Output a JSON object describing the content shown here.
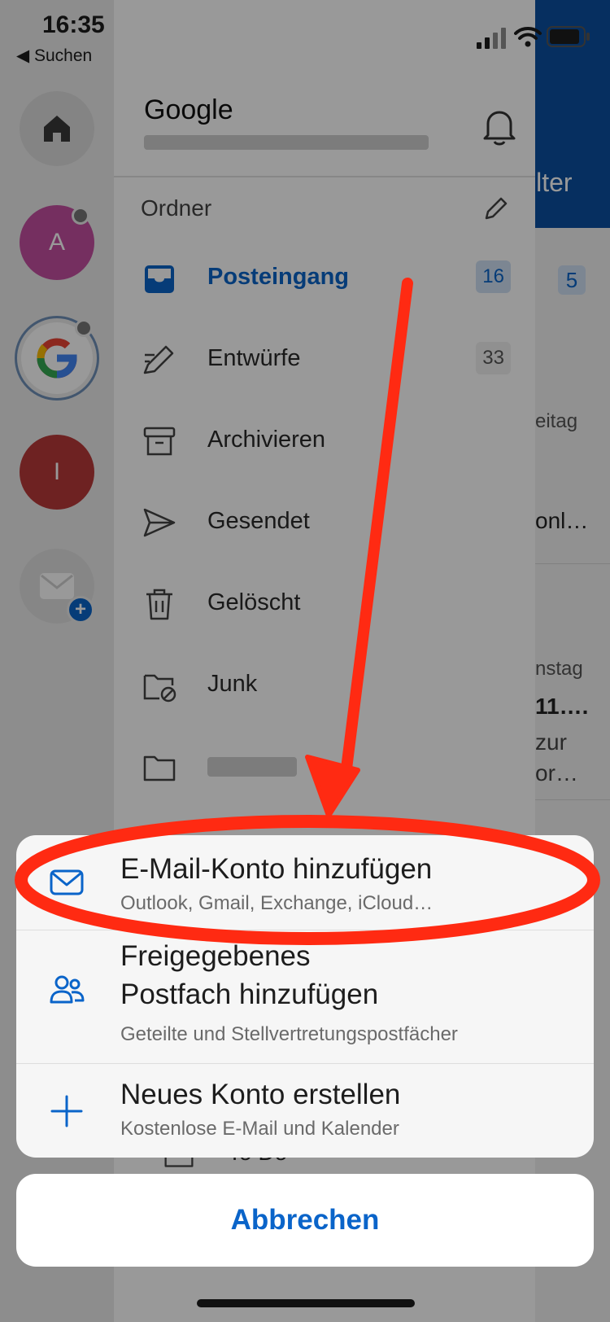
{
  "status_bar": {
    "time": "16:35",
    "back_label": "◀ Suchen"
  },
  "account": {
    "name": "Google"
  },
  "drawer": {
    "section_label": "Ordner",
    "folders": [
      {
        "label": "Posteingang",
        "count": "16",
        "icon": "inbox-icon",
        "active": true
      },
      {
        "label": "Entwürfe",
        "count": "33",
        "icon": "draft-pencil-icon",
        "active": false
      },
      {
        "label": "Archivieren",
        "count": "",
        "icon": "archive-icon",
        "active": false
      },
      {
        "label": "Gesendet",
        "count": "",
        "icon": "send-icon",
        "active": false
      },
      {
        "label": "Gelöscht",
        "count": "",
        "icon": "trash-icon",
        "active": false
      },
      {
        "label": "Junk",
        "count": "",
        "icon": "junk-folder-icon",
        "active": false
      },
      {
        "label": "",
        "count": "",
        "icon": "folder-icon",
        "active": false
      }
    ],
    "partial_folder": "To Do"
  },
  "rail": {
    "accounts": [
      {
        "initial": "A",
        "color": "#c44fa0"
      },
      {
        "initial": "G",
        "color": "#ffffff"
      },
      {
        "initial": "I",
        "color": "#b83a3a"
      }
    ]
  },
  "background_list": {
    "header_text": "ilter",
    "badge": "5",
    "snippets": [
      "eitag",
      "onl…",
      "nstag",
      "11….",
      "zur",
      "or…"
    ]
  },
  "action_sheet": {
    "options": [
      {
        "title": "E-Mail-Konto hinzufügen",
        "subtitle": "Outlook, Gmail, Exchange, iCloud…",
        "icon": "mail-icon"
      },
      {
        "title_line1": "Freigegebenes",
        "title_line2": "Postfach hinzufügen",
        "subtitle": "Geteilte und Stellvertretungspostfächer",
        "icon": "people-icon"
      },
      {
        "title": "Neues Konto erstellen",
        "subtitle": "Kostenlose E-Mail und Kalender",
        "icon": "plus-icon"
      }
    ],
    "cancel_label": "Abbrechen"
  },
  "colors": {
    "accent": "#0a64c9",
    "annotation": "#ff2a12",
    "header_blue": "#0a4fa0"
  }
}
